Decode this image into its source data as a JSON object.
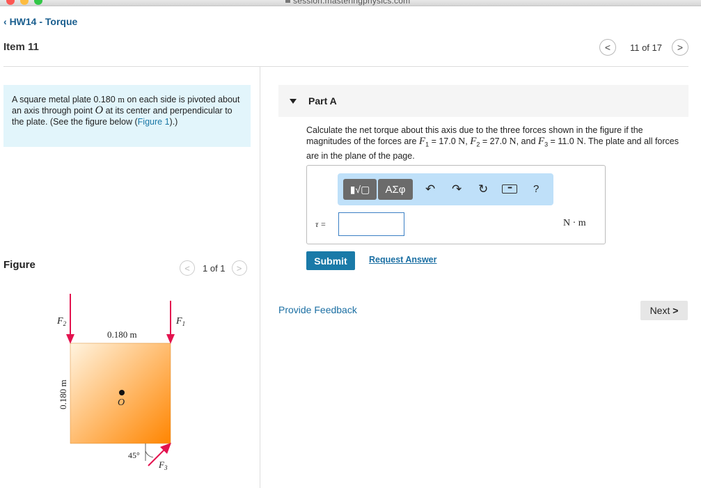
{
  "browser": {
    "url": "session.masteringphysics.com",
    "colors": {
      "close": "#fc5753",
      "minimize": "#fdbc40",
      "zoom": "#33c748"
    }
  },
  "header": {
    "back_label": "HW14 - Torque",
    "item_title": "Item 11",
    "pager": {
      "prev_icon": "chevron-left",
      "text": "11 of 17",
      "next_icon": "chevron-right"
    }
  },
  "intro": {
    "text_1": "A square metal plate 0.180 ",
    "unit_m": "m",
    "text_2": " on each side is pivoted about an axis through point ",
    "point": "O",
    "text_3": " at its center and perpendicular to the plate. (See the figure below (",
    "figure_link": "Figure 1",
    "text_4": ").)"
  },
  "figure": {
    "label": "Figure",
    "pager_text": "1 of 1",
    "side_top": "0.180 m",
    "side_left": "0.180 m",
    "center_label": "O",
    "f1": "F",
    "f1_sub": "1",
    "f2": "F",
    "f2_sub": "2",
    "f3": "F",
    "f3_sub": "3",
    "angle": "45°",
    "colors": {
      "arrow": "#e3134f",
      "plate_light": "#fff4e0",
      "plate_dark": "#ff8500"
    }
  },
  "part": {
    "title": "Part A",
    "q_1": "Calculate the net torque about this axis due to the three forces shown in the figure if the magnitudes of the forces are ",
    "F": "F",
    "s1": "1",
    "val1": " = 17.0 ",
    "u1": "N",
    "sep1": ", ",
    "s2": "2",
    "val2": " = 27.0 ",
    "u2": "N",
    "sep2": ", and ",
    "s3": "3",
    "val3": " = 11.0 ",
    "u3": "N",
    "q_2": ". The plate and all forces are in the plane of the page."
  },
  "answer": {
    "toolbar": {
      "template_btn": "▮√▢",
      "greek_btn": "ΑΣφ",
      "undo_icon": "undo-arrow",
      "redo_icon": "redo-arrow",
      "reset_icon": "reset",
      "keyboard_icon": "keyboard",
      "help": "?"
    },
    "symbol": "τ =",
    "input_value": "",
    "unit": "N · m"
  },
  "actions": {
    "submit": "Submit",
    "request_answer": "Request Answer",
    "feedback": "Provide Feedback",
    "next": "Next"
  }
}
